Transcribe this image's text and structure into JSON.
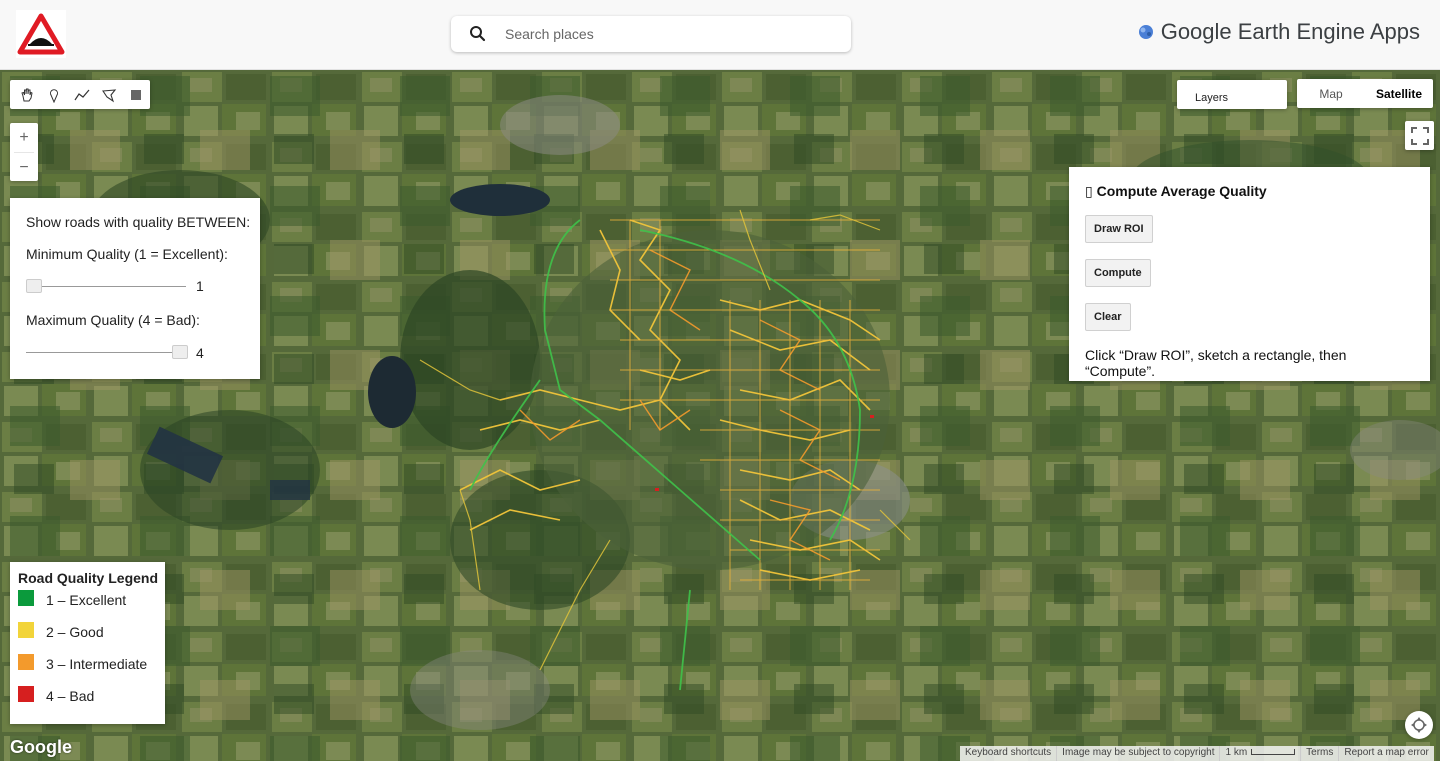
{
  "header": {
    "search_placeholder": "Search places",
    "brand_text": "Google Earth Engine Apps",
    "logo_icon": "road-bump-warning-icon"
  },
  "map": {
    "map_type": {
      "options": [
        "Map",
        "Satellite"
      ],
      "selected": "Satellite"
    },
    "layers_label": "Layers",
    "draw_tools": [
      "hand-pan-icon",
      "marker-icon",
      "polyline-icon",
      "polygon-icon",
      "rectangle-icon"
    ],
    "zoom_in": "+",
    "zoom_out": "−",
    "google_logo": "Google",
    "footer": {
      "shortcuts": "Keyboard shortcuts",
      "copyright": "Image may be subject to copyright",
      "scale": "1 km",
      "terms": "Terms",
      "report": "Report a map error"
    }
  },
  "filter_panel": {
    "heading": "Show roads with quality BETWEEN:",
    "min_label": "Minimum Quality (1 = Excellent):",
    "min_value": "1",
    "max_label": "Maximum Quality (4 = Bad):",
    "max_value": "4",
    "slider_range": [
      1,
      4
    ]
  },
  "compute_panel": {
    "title": "▯ Compute Average Quality",
    "draw_roi": "Draw ROI",
    "compute": "Compute",
    "clear": "Clear",
    "hint": "Click “Draw ROI”, sketch a rectangle, then “Compute”."
  },
  "legend": {
    "title": "Road Quality Legend",
    "items": [
      {
        "label": "1 – Excellent",
        "color": "#0b9a3c"
      },
      {
        "label": "2 – Good",
        "color": "#f2d43a"
      },
      {
        "label": "3 – Intermediate",
        "color": "#f39a2c"
      },
      {
        "label": "4 – Bad",
        "color": "#d61f1f"
      }
    ]
  }
}
